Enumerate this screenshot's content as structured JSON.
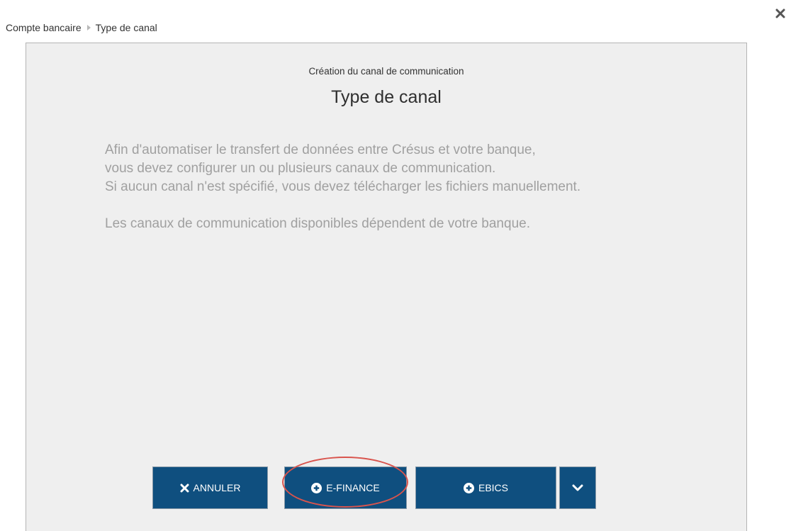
{
  "window": {
    "close_icon": "close-icon"
  },
  "breadcrumb": {
    "items": [
      {
        "label": "Compte bancaire"
      },
      {
        "label": "Type de canal"
      }
    ]
  },
  "dialog": {
    "subtitle": "Création du canal de communication",
    "title": "Type de canal",
    "description": [
      "Afin d'automatiser le transfert de données entre Crésus et votre banque,",
      "vous devez configurer un ou plusieurs canaux de communication.",
      "Si aucun canal n'est spécifié, vous devez télécharger les fichiers manuellement.",
      "Les canaux de communication disponibles dépendent de votre banque."
    ]
  },
  "buttons": {
    "cancel": {
      "label": "ANNULER",
      "icon": "x-icon"
    },
    "efinance": {
      "label": "E-FINANCE",
      "icon": "plus-circle-icon",
      "highlighted": true
    },
    "ebics": {
      "label": "EBICS",
      "icon": "plus-circle-icon"
    },
    "more": {
      "icon": "chevron-down-icon"
    }
  },
  "colors": {
    "button_bg": "#0f4f7f",
    "panel_bg": "#efefef",
    "description_text": "#a0a0a0",
    "highlight": "#d9544d"
  }
}
